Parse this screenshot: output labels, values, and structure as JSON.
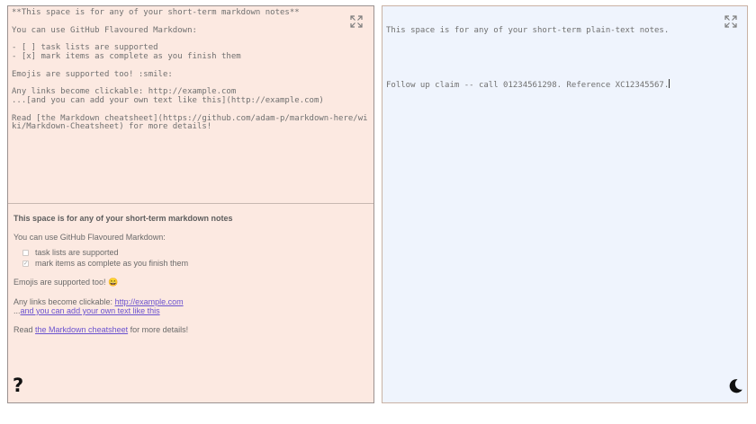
{
  "markdown_panel": {
    "editor_text": "**This space is for any of your short-term markdown notes**\n\nYou can use GitHub Flavoured Markdown:\n\n- [ ] task lists are supported\n- [x] mark items as complete as you finish them\n\nEmojis are supported too! :smile:\n\nAny links become clickable: http://example.com\n...[and you can add your own text like this](http://example.com)\n\nRead [the Markdown cheatsheet](https://github.com/adam-p/markdown-here/wiki/Markdown-Cheatsheet) for more details!",
    "preview": {
      "title": "This space is for any of your short-term markdown notes",
      "intro": "You can use GitHub Flavoured Markdown:",
      "tasks": [
        {
          "label": "task lists are supported",
          "checked": false
        },
        {
          "label": "mark items as complete as you finish them",
          "checked": true
        }
      ],
      "emoji_text": "Emojis are supported too! 😄",
      "links_prefix": "Any links become clickable: ",
      "link_url": "http://example.com",
      "custom_prefix": "...",
      "custom_link": "and you can add your own text like this",
      "read_prefix": "Read ",
      "cheatsheet_link": "the Markdown cheatsheet",
      "read_suffix": " for more details!"
    }
  },
  "plaintext_panel": {
    "line1": "This space is for any of your short-term plain-text notes.",
    "line2": "Follow up claim -- call 01234561298. Reference XC12345567."
  },
  "icons": {
    "expand": "expand-icon",
    "help": "?",
    "theme": "moon-icon"
  },
  "colors": {
    "markdown_bg": "#fce9e1",
    "plaintext_bg": "#eff4fd",
    "link": "#6a52cf"
  }
}
